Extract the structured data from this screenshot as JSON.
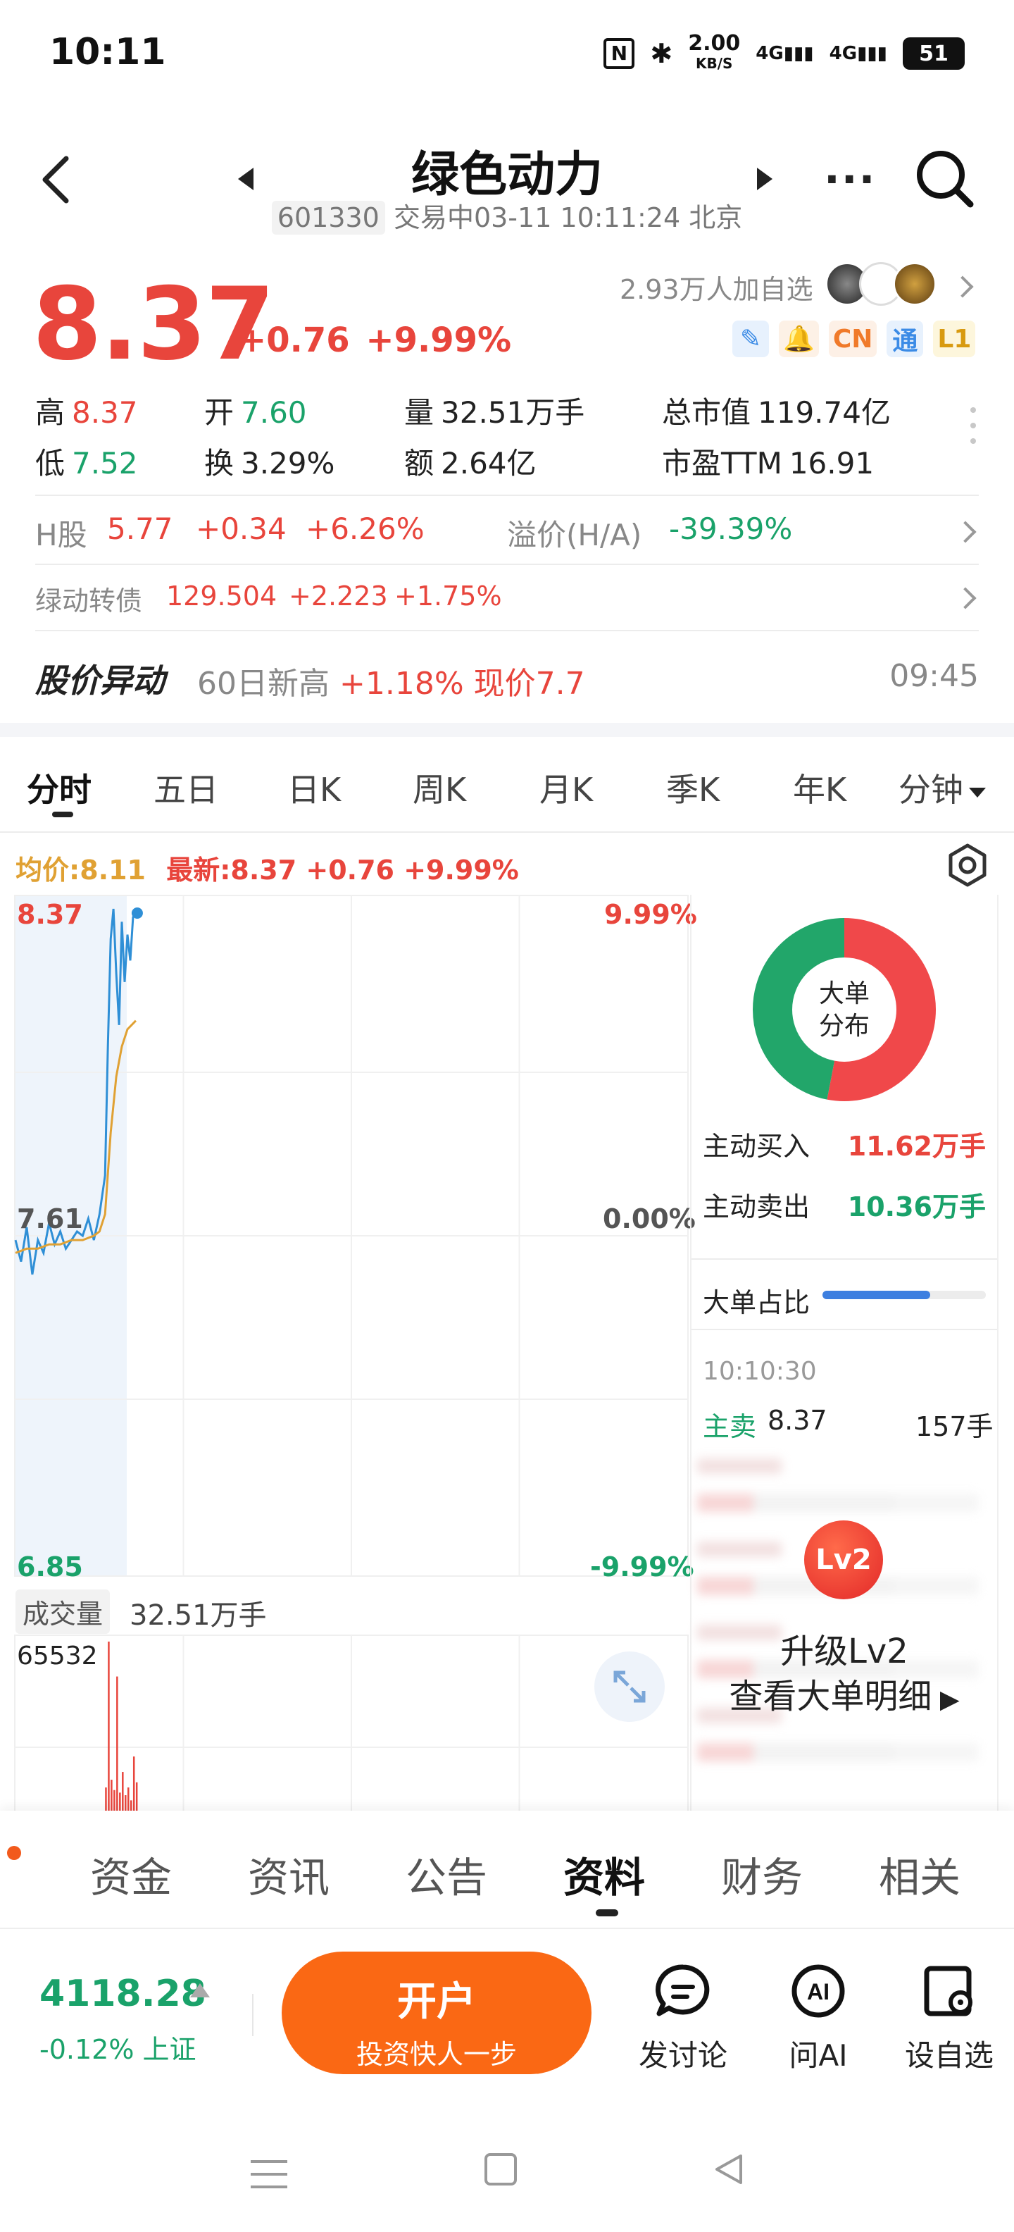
{
  "status_bar": {
    "time": "10:11",
    "net_speed_top": "2.00",
    "net_speed_unit": "KB/S",
    "sig1": "4G",
    "sig2": "4G",
    "battery": "51"
  },
  "header": {
    "title": "绿色动力",
    "code": "601330",
    "status": "交易中03-11 10:11:24 北京"
  },
  "quote": {
    "price": "8.37",
    "change": "+0.76",
    "change_pct": "+9.99%",
    "followers": "2.93万人加自选",
    "badges": [
      "CN",
      "通",
      "L1"
    ]
  },
  "stats": [
    {
      "label": "高",
      "value": "8.37",
      "color": "#e8453c"
    },
    {
      "label": "开",
      "value": "7.60",
      "color": "#1aa26a"
    },
    {
      "label": "量",
      "value": "32.51万手",
      "color": "#222222"
    },
    {
      "label": "总市值",
      "value": "119.74亿",
      "color": "#222222"
    },
    {
      "label": "低",
      "value": "7.52",
      "color": "#1aa26a"
    },
    {
      "label": "换",
      "value": "3.29%",
      "color": "#222222"
    },
    {
      "label": "额",
      "value": "2.64亿",
      "color": "#222222"
    },
    {
      "label": "市盈TTM",
      "value": "16.91",
      "color": "#222222"
    }
  ],
  "h_share": {
    "label": "H股",
    "price": "5.77",
    "change": "+0.34",
    "pct": "+6.26%",
    "premium_label": "溢价(H/A)",
    "premium": "-39.39%"
  },
  "convertible": {
    "label": "绿动转债",
    "price": "129.504",
    "change": "+2.223",
    "pct": "+1.75%"
  },
  "anomaly": {
    "title": "股价异动",
    "text_prefix": "60日新高",
    "text_highlight": "+1.18% 现价7.7",
    "time": "09:45"
  },
  "chart_tabs": [
    "分时",
    "五日",
    "日K",
    "周K",
    "月K",
    "季K",
    "年K",
    "分钟"
  ],
  "chart_legend": {
    "avg": "均价:8.11",
    "latest": "最新:8.37 +0.76 +9.99%"
  },
  "chart_axes": {
    "top_price": "8.37",
    "mid_price": "7.61",
    "bottom_price": "6.85",
    "top_pct": "9.99%",
    "mid_pct": "0.00%",
    "bottom_pct": "-9.99%"
  },
  "chart_data": {
    "type": "line",
    "title": "",
    "ylim": [
      6.85,
      8.37
    ],
    "xlim": [
      0,
      240
    ],
    "colors": {
      "price": "#2f8fd6",
      "avg": "#e0a133",
      "volume": "#e8453c"
    },
    "series": [
      {
        "x": [
          0,
          2,
          4,
          6,
          8,
          10,
          12,
          14,
          16,
          18,
          20,
          22,
          24,
          26,
          28,
          30,
          32,
          33,
          34,
          35,
          36,
          37,
          38,
          39,
          40,
          41,
          42,
          43
        ],
        "values": [
          7.6,
          7.55,
          7.63,
          7.52,
          7.6,
          7.57,
          7.64,
          7.59,
          7.62,
          7.58,
          7.6,
          7.62,
          7.61,
          7.65,
          7.6,
          7.66,
          7.75,
          8.05,
          8.3,
          8.37,
          8.22,
          8.1,
          8.34,
          8.2,
          8.31,
          8.25,
          8.35,
          8.37
        ]
      },
      {
        "x": [
          0,
          4,
          8,
          12,
          16,
          20,
          24,
          28,
          30,
          32,
          34,
          36,
          38,
          40,
          43
        ],
        "values": [
          7.57,
          7.58,
          7.58,
          7.59,
          7.59,
          7.6,
          7.6,
          7.61,
          7.62,
          7.66,
          7.85,
          7.98,
          8.05,
          8.09,
          8.11
        ]
      }
    ],
    "volume": {
      "max_label": "65532",
      "x": [
        32,
        33,
        34,
        35,
        36,
        37,
        38,
        39,
        40,
        41,
        42,
        43
      ],
      "values": [
        9000,
        65532,
        12000,
        8000,
        52000,
        7000,
        15000,
        6000,
        9000,
        4000,
        21000,
        11000
      ]
    }
  },
  "volume": {
    "chip": "成交量",
    "total": "32.51万手"
  },
  "right_panel": {
    "donut_label_1": "大单",
    "donut_label_2": "分布",
    "buy_share": 0.53,
    "buy_label": "主动买入",
    "buy_value": "11.62万手",
    "sell_label": "主动卖出",
    "sell_value": "10.36万手",
    "ratio_label": "大单占比",
    "ratio": 0.66,
    "trade_time": "10:10:30",
    "trade_side": "主卖",
    "trade_price": "8.37",
    "trade_qty": "157手",
    "lv2_badge": "Lv2",
    "upgrade_line1": "升级Lv2",
    "upgrade_line2": "查看大单明细"
  },
  "bottom_tabs": [
    "资金",
    "资讯",
    "公告",
    "资料",
    "财务",
    "相关"
  ],
  "index": {
    "value": "4118.28",
    "change": "-0.12%",
    "name": "上证"
  },
  "open_button": {
    "label": "开户",
    "sub": "投资快人一步"
  },
  "actions": [
    {
      "label": "发讨论",
      "icon": "discuss-icon"
    },
    {
      "label": "问AI",
      "icon": "ai-icon"
    },
    {
      "label": "设自选",
      "icon": "watchlist-icon"
    }
  ]
}
